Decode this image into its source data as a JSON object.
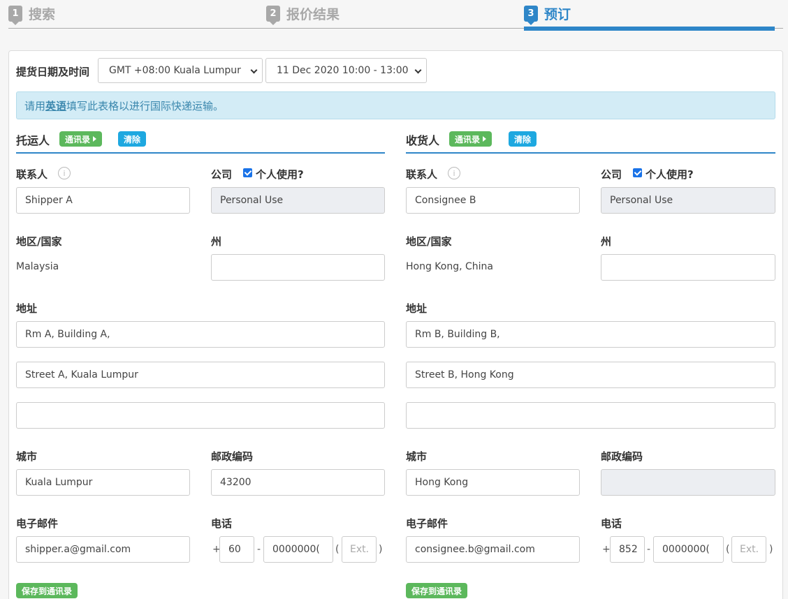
{
  "steps": [
    {
      "num": "1",
      "label": "搜索"
    },
    {
      "num": "2",
      "label": "报价结果"
    },
    {
      "num": "3",
      "label": "预订"
    }
  ],
  "pickup": {
    "label": "提货日期及时间",
    "timezone": "GMT +08:00 Kuala Lumpur",
    "datetime": "11 Dec 2020 10:00 - 13:00"
  },
  "notice": {
    "pre": "请用",
    "bold": "英语",
    "post": "填写此表格以进行国际快递运输。"
  },
  "labels": {
    "contact": "联系人",
    "company": "公司",
    "personal": "个人使用?",
    "country": "地区/国家",
    "state": "州",
    "address": "地址",
    "city": "城市",
    "postcode": "邮政编码",
    "email": "电子邮件",
    "phone": "电话",
    "address_book": "通讯录",
    "clear": "清除",
    "save_to_book": "保存到通讯录",
    "ext_placeholder": "Ext.",
    "info_icon": "i"
  },
  "shipper": {
    "title": "托运人",
    "contact": "Shipper A",
    "company": "Personal Use",
    "country": "Malaysia",
    "state": "",
    "address1": "Rm A, Building A,",
    "address2": "Street A, Kuala Lumpur",
    "address3": "",
    "city": "Kuala Lumpur",
    "postcode": "43200",
    "email": "shipper.a@gmail.com",
    "phone_code": "60",
    "phone_number": "0000000(",
    "ext": ""
  },
  "consignee": {
    "title": "收货人",
    "contact": "Consignee B",
    "company": "Personal Use",
    "country": "Hong Kong, China",
    "state": "",
    "address1": "Rm B, Building B,",
    "address2": "Street B, Hong Kong",
    "address3": "",
    "city": "Hong Kong",
    "postcode": "",
    "email": "consignee.b@gmail.com",
    "phone_code": "852",
    "phone_number": "0000000(",
    "ext": ""
  },
  "punct": {
    "plus": "+",
    "dash": "-",
    "lparen": "(",
    "rparen": ")"
  },
  "colors": {
    "accent": "#2e86c8",
    "green": "#5cb85c",
    "blue": "#1ea8e0",
    "notice_bg": "#d3ecf6"
  }
}
